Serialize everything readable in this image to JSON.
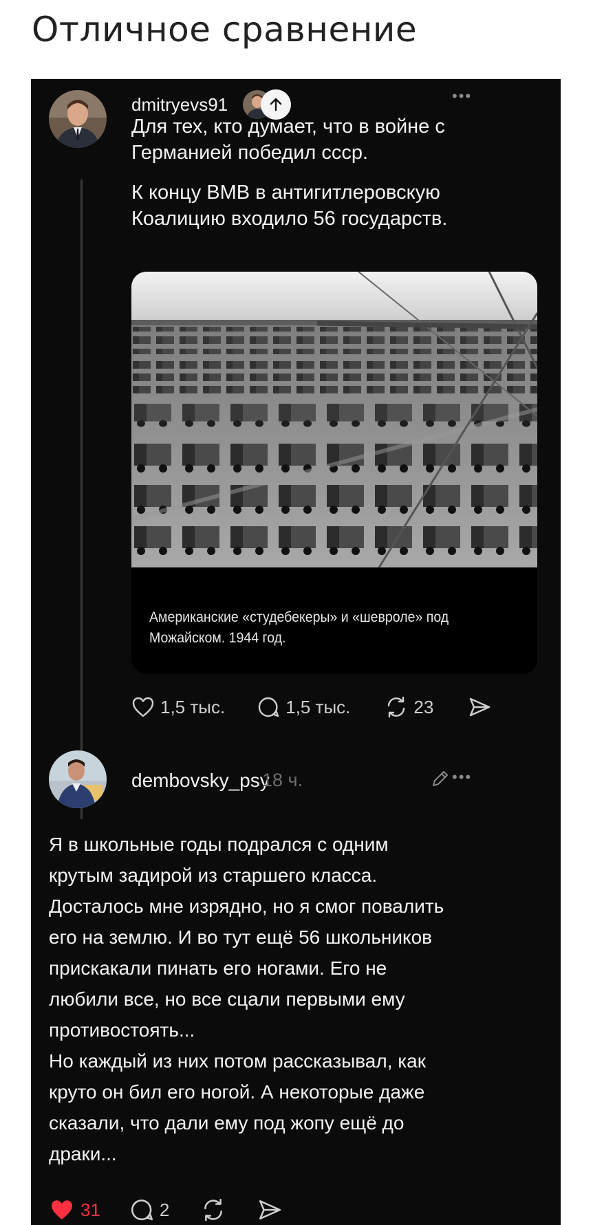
{
  "page": {
    "title": "Отличное сравнение"
  },
  "post1": {
    "username": "dmitryevs91",
    "text_line1": "Для тех, кто думает, что в войне с\nГерманией победил ссср.",
    "text_line2": "К концу ВМВ в антигитлеровскую\nКоалицию входило 56 государств.",
    "image_caption": "Американские «студебекеры» и «шевроле» под\nМожайском. 1944 год.",
    "likes": "1,5 тыс.",
    "replies": "1,5 тыс.",
    "reposts": "23"
  },
  "post2": {
    "username": "dembovsky_psy",
    "timestamp": "18 ч.",
    "text": "Я в школьные годы подрался с одним\nкрутым задирой из старшего класса.\nДосталось мне изрядно, но я смог повалить\nего на землю. И во тут ещё 56 школьников\nприскакали пинать его ногами. Его не\nлюбили все, но все сцали первыми ему\nпротивостоять...\nНо каждый из них потом рассказывал, как\nкруто он бил его ногой. А некоторые даже\nсказали, что дали ему под жопу ещё до\nдраки...",
    "likes": "31",
    "replies": "2"
  },
  "colors": {
    "background": "#0b0b0b",
    "like_active": "#ff3040",
    "text": "#f2f2f2",
    "muted": "#6e6e6e"
  },
  "icons": [
    "more-icon",
    "follow-arrow-icon",
    "heart-icon",
    "comment-icon",
    "repost-icon",
    "share-icon",
    "edit-icon"
  ]
}
